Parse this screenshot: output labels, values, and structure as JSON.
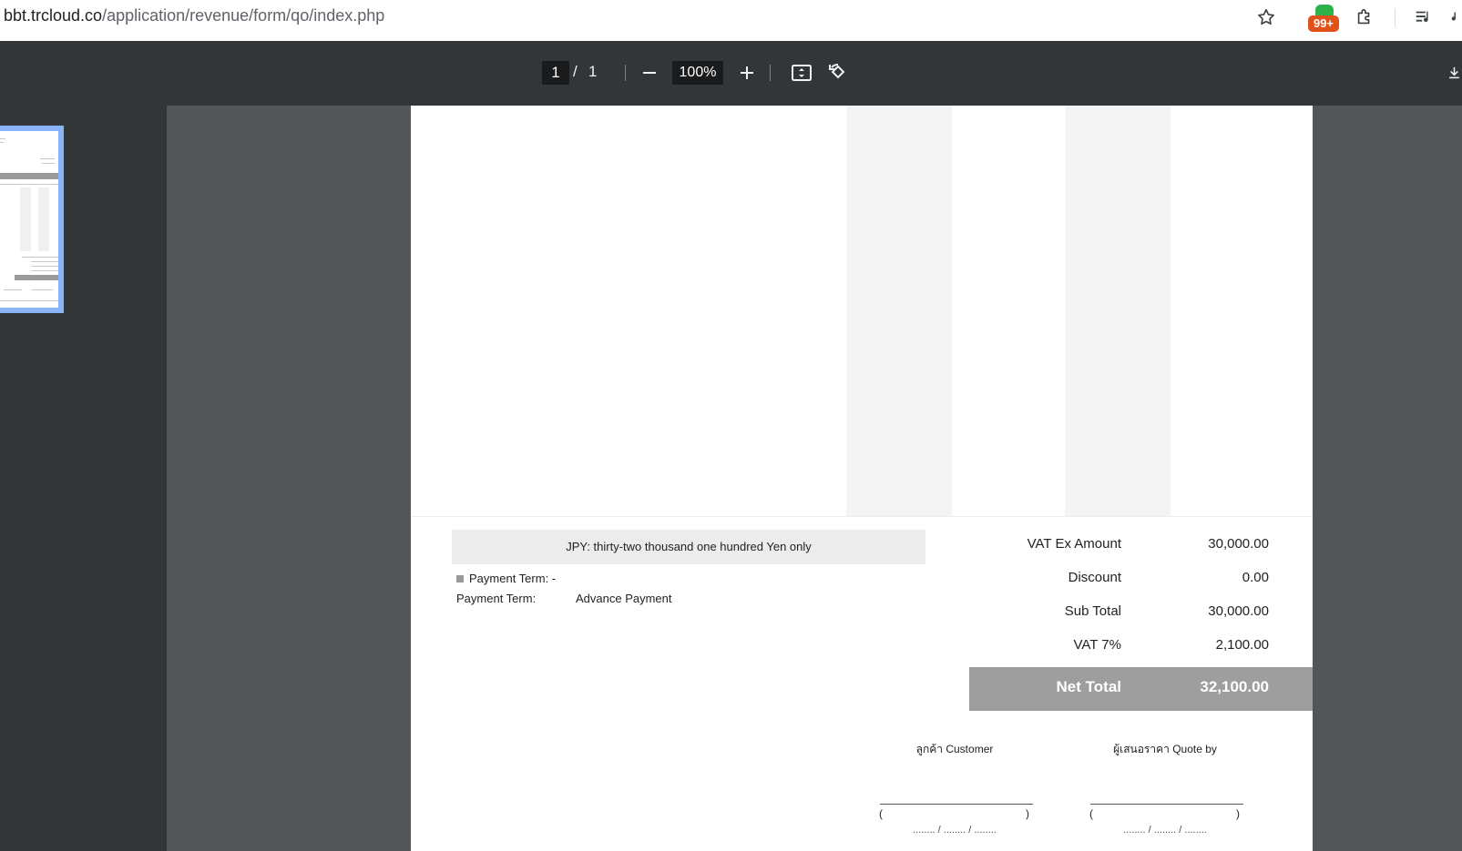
{
  "browser": {
    "url_host": "bbt.trcloud.co",
    "url_path": "/application/revenue/form/qo/index.php",
    "extension_badge": "99+",
    "icons": [
      "star-icon",
      "extension-badge-icon",
      "puzzle-icon",
      "media-list-icon"
    ]
  },
  "pdf_toolbar": {
    "current_page": "1",
    "separator": "/",
    "total_pages": "1",
    "zoom": "100%",
    "icons": [
      "zoom-out-icon",
      "zoom-in-icon",
      "fit-page-icon",
      "rotate-icon",
      "download-icon"
    ]
  },
  "document": {
    "amount_in_words": "JPY: thirty-two thousand one hundred Yen only",
    "payment_term_line1": "Payment Term: -",
    "payment_term_label": "Payment Term:",
    "payment_term_value": "Advance Payment",
    "summary": [
      {
        "label": "VAT Ex Amount",
        "value": "30,000.00"
      },
      {
        "label": "Discount",
        "value": "0.00"
      },
      {
        "label": "Sub Total",
        "value": "30,000.00"
      },
      {
        "label": "VAT 7%",
        "value": "2,100.00"
      }
    ],
    "net_total_label": "Net Total",
    "net_total_value": "32,100.00",
    "signatures": [
      {
        "title": "ลูกค้า Customer",
        "paren_open": "(",
        "paren_close": ")",
        "date": "........ / ........ / ........"
      },
      {
        "title": "ผู้เสนอราคา Quote by",
        "paren_open": "(",
        "paren_close": ")",
        "date": "........ / ........ / ........"
      }
    ],
    "accent_colors": {
      "net_total_bg": "#9e9e9e",
      "words_bg": "#ececec"
    }
  }
}
